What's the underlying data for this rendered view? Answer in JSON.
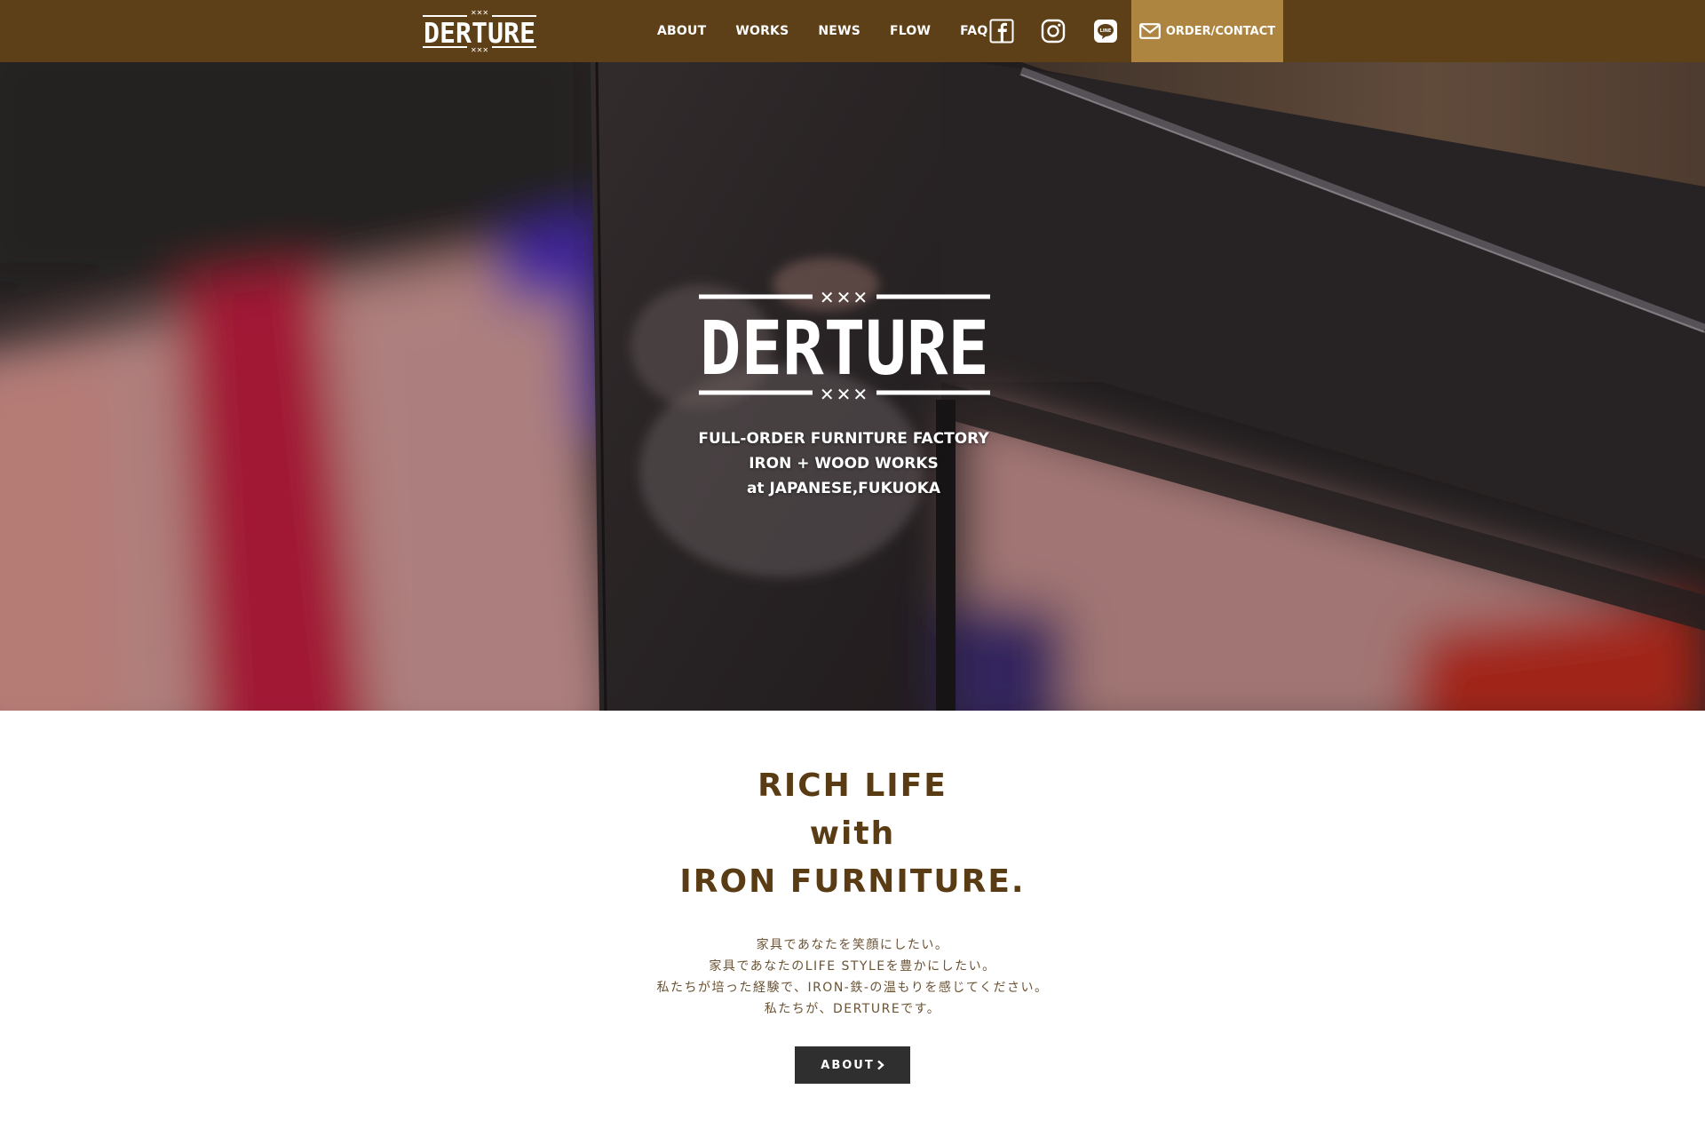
{
  "brand": {
    "name": "DERTURE",
    "colors": {
      "header_bg": "#5e4018",
      "order_bg": "#ad8540",
      "heading_text": "#5a3c14",
      "button_bg": "#2f2f2f"
    }
  },
  "nav": {
    "items": [
      {
        "label": "ABOUT"
      },
      {
        "label": "WORKS"
      },
      {
        "label": "NEWS"
      },
      {
        "label": "FLOW"
      },
      {
        "label": "FAQ"
      }
    ],
    "social_icons": [
      "facebook-icon",
      "instagram-icon",
      "line-icon"
    ],
    "order_label": "ORDER/CONTACT",
    "order_icon": "mail-icon"
  },
  "hero": {
    "logo_text": "DERTURE",
    "tagline": [
      "FULL-ORDER FURNITURE FACTORY",
      "IRON + WOOD WORKS",
      "at JAPANESE,FUKUOKA"
    ]
  },
  "intro": {
    "heading": [
      "RICH LIFE",
      "with",
      "IRON FURNITURE."
    ],
    "body": [
      "家具であなたを笑顔にしたい。",
      "家具であなたのLIFE STYLEを豊かにしたい。",
      "私たちが培った経験で、IRON-鉄-の温もりを感じてください。",
      "私たちが、DERTUREです。"
    ],
    "button_label": "ABOUT",
    "button_icon": "chevron-right-icon"
  }
}
